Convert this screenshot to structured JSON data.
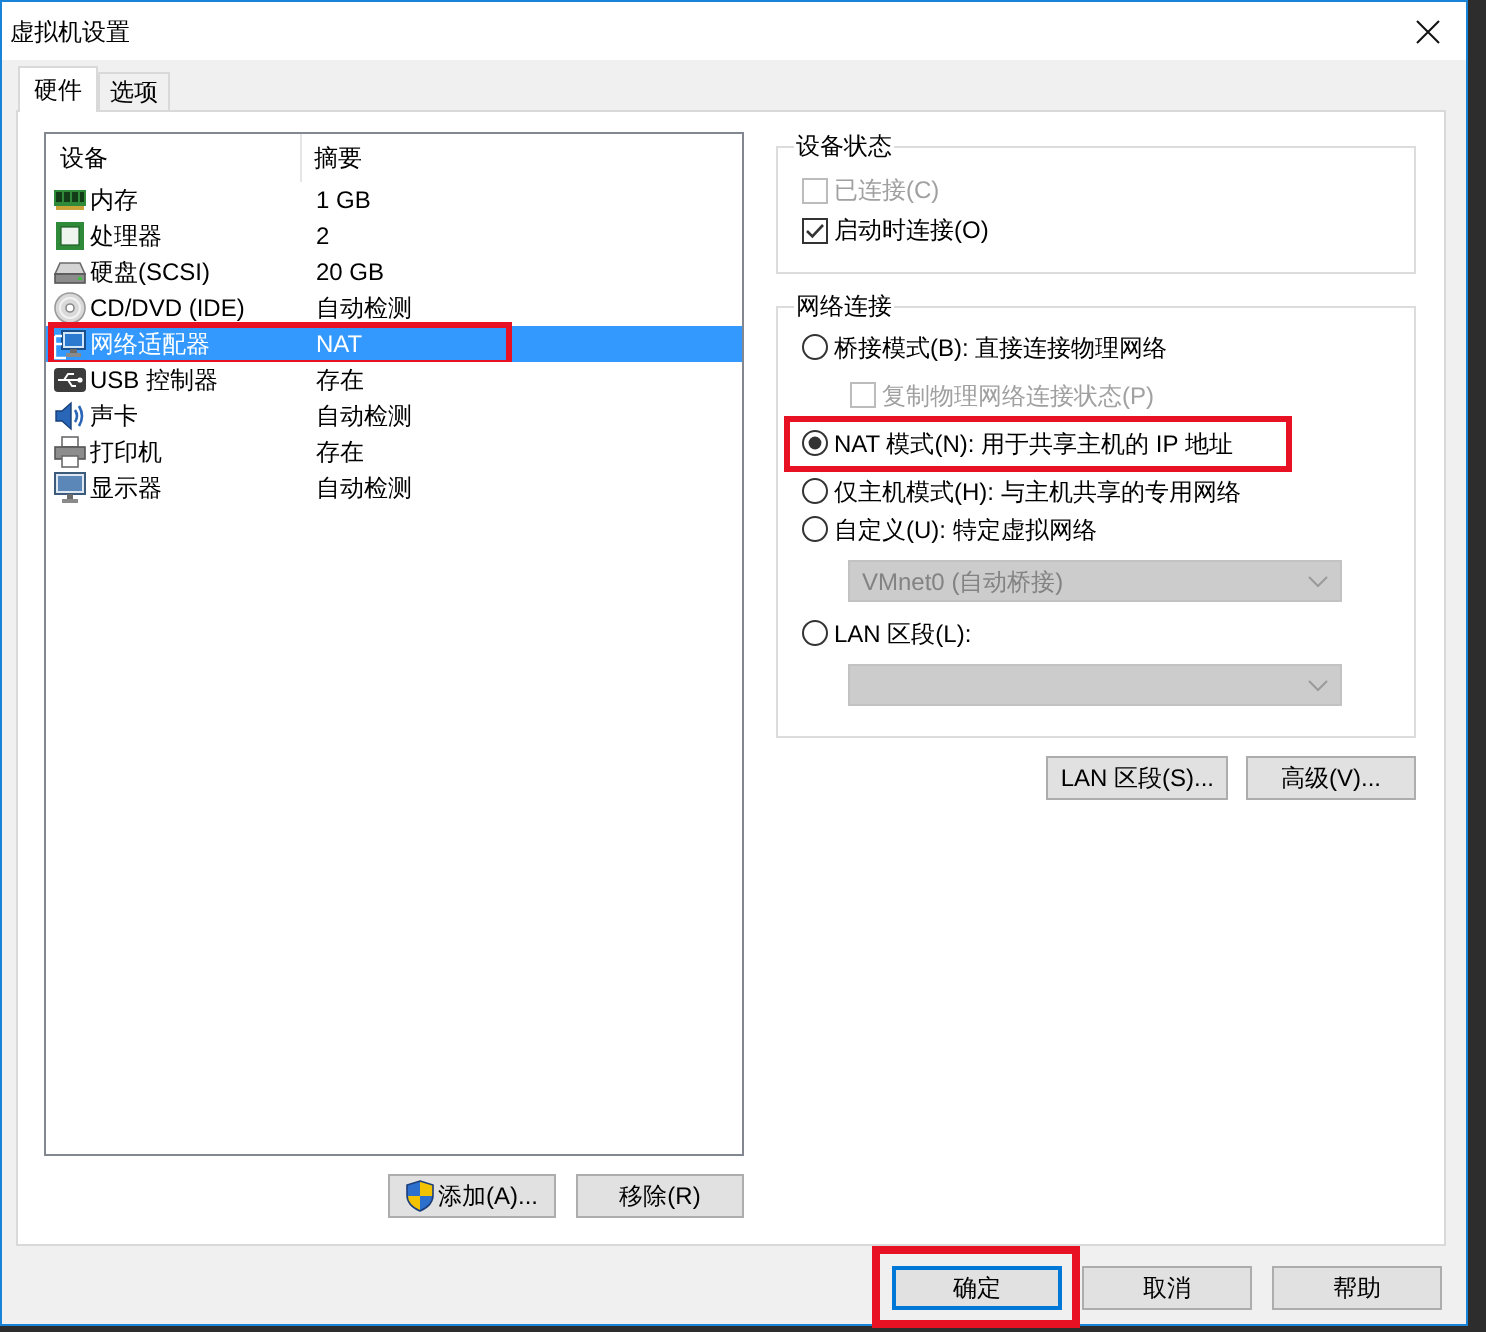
{
  "window": {
    "title": "虚拟机设置"
  },
  "tabs": [
    {
      "label": "硬件",
      "selected": true
    },
    {
      "label": "选项",
      "selected": false
    }
  ],
  "device_list": {
    "columns": [
      "设备",
      "摘要"
    ],
    "rows": [
      {
        "kind": "memory",
        "device": "内存",
        "summary": "1 GB",
        "selected": false,
        "highlighted": false
      },
      {
        "kind": "processor",
        "device": "处理器",
        "summary": "2",
        "selected": false,
        "highlighted": false
      },
      {
        "kind": "disk",
        "device": "硬盘(SCSI)",
        "summary": "20 GB",
        "selected": false,
        "highlighted": false
      },
      {
        "kind": "cdrom",
        "device": "CD/DVD (IDE)",
        "summary": "自动检测",
        "selected": false,
        "highlighted": false
      },
      {
        "kind": "network",
        "device": "网络适配器",
        "summary": "NAT",
        "selected": true,
        "highlighted": true
      },
      {
        "kind": "usb",
        "device": "USB 控制器",
        "summary": "存在",
        "selected": false,
        "highlighted": false
      },
      {
        "kind": "sound",
        "device": "声卡",
        "summary": "自动检测",
        "selected": false,
        "highlighted": false
      },
      {
        "kind": "printer",
        "device": "打印机",
        "summary": "存在",
        "selected": false,
        "highlighted": false
      },
      {
        "kind": "display",
        "device": "显示器",
        "summary": "自动检测",
        "selected": false,
        "highlighted": false
      }
    ]
  },
  "list_buttons": [
    {
      "label": "添加(A)...",
      "kind": "elevated"
    },
    {
      "label": "移除(R)",
      "kind": "plain"
    }
  ],
  "device_status": {
    "title": "设备状态",
    "options": [
      {
        "label": "已连接(C)",
        "checked": false,
        "disabled": true
      },
      {
        "label": "启动时连接(O)",
        "checked": true,
        "disabled": false
      }
    ]
  },
  "network_connection": {
    "title": "网络连接",
    "options": [
      {
        "kind": "radio",
        "label": "桥接模式(B): 直接连接物理网络",
        "selected": false,
        "disabled": false,
        "highlighted": false
      },
      {
        "kind": "checkbox",
        "label": "复制物理网络连接状态(P)",
        "checked": false,
        "disabled": true,
        "highlighted": false
      },
      {
        "kind": "radio",
        "label": "NAT 模式(N): 用于共享主机的 IP 地址",
        "selected": true,
        "disabled": false,
        "highlighted": true
      },
      {
        "kind": "radio",
        "label": "仅主机模式(H): 与主机共享的专用网络",
        "selected": false,
        "disabled": false,
        "highlighted": false
      },
      {
        "kind": "radio",
        "label": "自定义(U): 特定虚拟网络",
        "selected": false,
        "disabled": false,
        "highlighted": false
      },
      {
        "kind": "dropdown",
        "value": "VMnet0 (自动桥接)",
        "disabled": true,
        "highlighted": false
      },
      {
        "kind": "radio",
        "label": "LAN 区段(L):",
        "selected": false,
        "disabled": false,
        "highlighted": false
      },
      {
        "kind": "dropdown",
        "disabled": true,
        "highlighted": false
      }
    ]
  },
  "network_buttons": [
    "LAN 区段(S)...",
    "高级(V)..."
  ],
  "dialog_buttons": [
    {
      "label": "确定",
      "default": true,
      "highlighted": true
    },
    {
      "label": "取消",
      "default": false,
      "highlighted": false
    },
    {
      "label": "帮助",
      "default": false,
      "highlighted": false
    }
  ]
}
